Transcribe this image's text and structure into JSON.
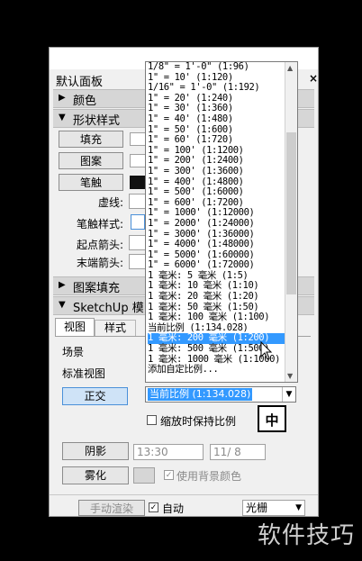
{
  "panel": {
    "title": "默认面板",
    "close_glyph": "×",
    "sections": {
      "color": "颜色",
      "shape_style": "形状样式",
      "pattern_fill": "图案填充",
      "sketchup_model": "SketchUp 模"
    },
    "shape_style": {
      "fill_button": "填充",
      "pattern_button": "图案",
      "stroke_button": "笔触",
      "dash_label": "虚线:",
      "stroke_style_label": "笔触样式:",
      "start_arrow_label": "起点箭头:",
      "end_arrow_label": "末端箭头:"
    },
    "model": {
      "tabs": [
        "视图",
        "样式"
      ],
      "scene_label": "场景",
      "standard_view_label": "标准视图",
      "ortho_button": "正交",
      "scale_combo_value": "当前比例 (1:134.028)",
      "keep_scale_checkbox_label": "缩放时保持比例",
      "shadow_button": "阴影",
      "shadow_time": "13:30",
      "shadow_date": "11/ 8",
      "fog_button": "雾化",
      "use_bg_color_label": "使用背景颜色",
      "manual_render_button": "手动渲染",
      "auto_label": "自动",
      "render_mode": "光栅"
    }
  },
  "dropdown": {
    "items": [
      "1/8\" = 1'-0\" (1:96)",
      "1\" = 10' (1:120)",
      "1/16\" = 1'-0\" (1:192)",
      "1\" = 20' (1:240)",
      "1\" = 30' (1:360)",
      "1\" = 40' (1:480)",
      "1\" = 50' (1:600)",
      "1\" = 60' (1:720)",
      "1\" = 100' (1:1200)",
      "1\" = 200' (1:2400)",
      "1\" = 300' (1:3600)",
      "1\" = 400' (1:4800)",
      "1\" = 500' (1:6000)",
      "1\" = 600' (1:7200)",
      "1\" = 1000' (1:12000)",
      "1\" = 2000' (1:24000)",
      "1\" = 3000' (1:36000)",
      "1\" = 4000' (1:48000)",
      "1\" = 5000' (1:60000)",
      "1\" = 6000' (1:72000)",
      "1 毫米: 5 毫米 (1:5)",
      "1 毫米: 10 毫米 (1:10)",
      "1 毫米: 20 毫米 (1:20)",
      "1 毫米: 50 毫米 (1:50)",
      "1 毫米: 100 毫米 (1:100)",
      "当前比例 (1:134.028)",
      "1 毫米: 200 毫米 (1:200)",
      "1 毫米: 500 毫米 (1:500)",
      "1 毫米: 1000 毫米 (1:1000)",
      "添加自定比例..."
    ],
    "selected_index": 26
  },
  "ime_indicator": "中",
  "watermark": "软件技巧"
}
